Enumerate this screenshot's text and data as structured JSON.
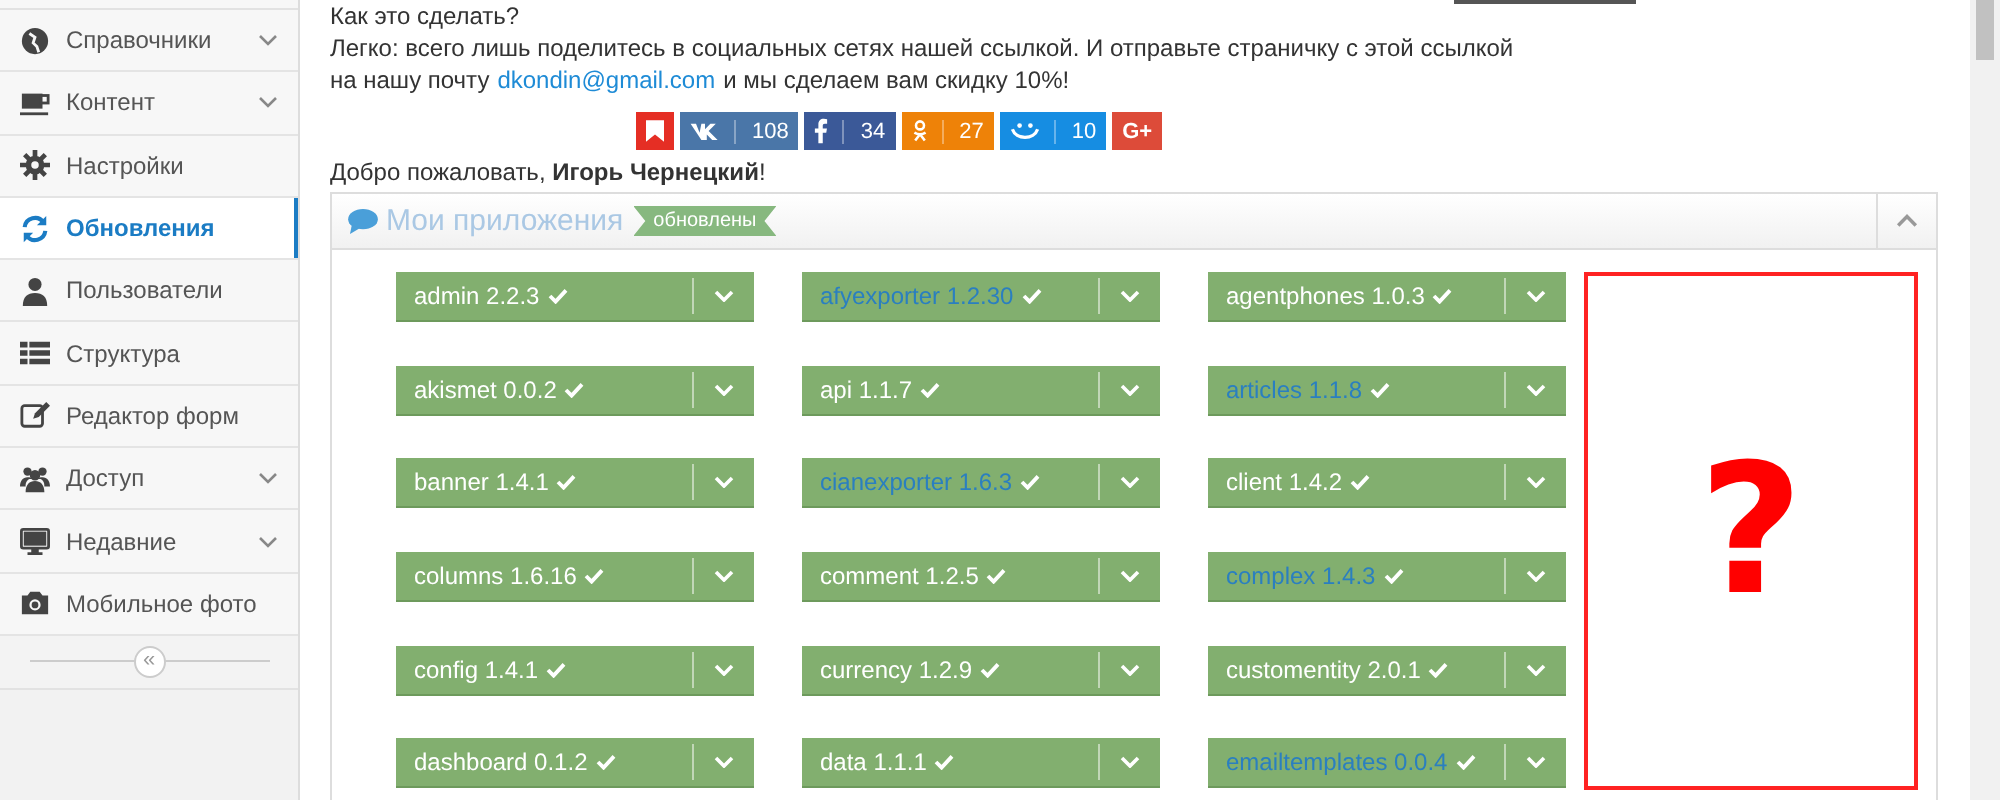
{
  "sidebar": {
    "items": [
      {
        "label": "Справочники",
        "kind": "globe",
        "expandable": true,
        "selected": false
      },
      {
        "label": "Контент",
        "kind": "cup",
        "expandable": true,
        "selected": false
      },
      {
        "label": "Настройки",
        "kind": "gear",
        "expandable": false,
        "selected": false
      },
      {
        "label": "Обновления",
        "kind": "refresh",
        "expandable": false,
        "selected": true
      },
      {
        "label": "Пользователи",
        "kind": "user",
        "expandable": false,
        "selected": false
      },
      {
        "label": "Структура",
        "kind": "list",
        "expandable": false,
        "selected": false
      },
      {
        "label": "Редактор форм",
        "kind": "edit",
        "expandable": false,
        "selected": false
      },
      {
        "label": "Доступ",
        "kind": "users",
        "expandable": true,
        "selected": false
      },
      {
        "label": "Недавние",
        "kind": "monitor",
        "expandable": true,
        "selected": false
      },
      {
        "label": "Мобильное фото",
        "kind": "camera",
        "expandable": false,
        "selected": false
      }
    ],
    "collapse_button": "«"
  },
  "promo": {
    "question": "Как это сделать?",
    "text": "Легко: всего лишь поделитесь в социальных сетях нашей ссылкой. И отправьте страничку с этой ссылкой",
    "text2_before": "на нашу почту",
    "email": "dkondin@gmail.com",
    "text2_after": "и мы сделаем вам скидку 10%!"
  },
  "share_buttons": [
    {
      "kind": "bookmark",
      "color": "#e52e24"
    },
    {
      "kind": "vk",
      "color": "#4a76a8",
      "count": "108"
    },
    {
      "kind": "facebook",
      "color": "#3b5998",
      "count": "34"
    },
    {
      "kind": "ok",
      "color": "#ee8208",
      "count": "27"
    },
    {
      "kind": "mailru",
      "color": "#168de2",
      "count": "10"
    },
    {
      "kind": "gplus",
      "color": "#dd4b39",
      "label": "G+"
    }
  ],
  "welcome": {
    "text": "Добро пожаловать, **Игорь Чернецкий**!"
  },
  "panel": {
    "title": "Мои приложения",
    "badge": "обновлены",
    "expanded": true,
    "apps": [
      {
        "name": "admin 2.2.3",
        "kind": "plain"
      },
      {
        "name": "afyexporter 1.2.30",
        "kind": "link"
      },
      {
        "name": "agentphones 1.0.3",
        "kind": "plain"
      },
      {
        "name": "akismet 0.0.2",
        "kind": "plain"
      },
      {
        "name": "api 1.1.7",
        "kind": "plain"
      },
      {
        "name": "articles 1.1.8",
        "kind": "link"
      },
      {
        "name": "banner 1.4.1",
        "kind": "plain"
      },
      {
        "name": "cianexporter 1.6.3",
        "kind": "link"
      },
      {
        "name": "client 1.4.2",
        "kind": "plain"
      },
      {
        "name": "columns 1.6.16",
        "kind": "plain"
      },
      {
        "name": "comment 1.2.5",
        "kind": "plain"
      },
      {
        "name": "complex 1.4.3",
        "kind": "link"
      },
      {
        "name": "config 1.4.1",
        "kind": "plain"
      },
      {
        "name": "currency 1.2.9",
        "kind": "plain"
      },
      {
        "name": "customentity 2.0.1",
        "kind": "plain"
      },
      {
        "name": "dashboard 0.1.2",
        "kind": "plain"
      },
      {
        "name": "data 1.1.1",
        "kind": "plain"
      },
      {
        "name": "emailtemplates 0.0.4",
        "kind": "link"
      }
    ],
    "question_mark": "?"
  }
}
